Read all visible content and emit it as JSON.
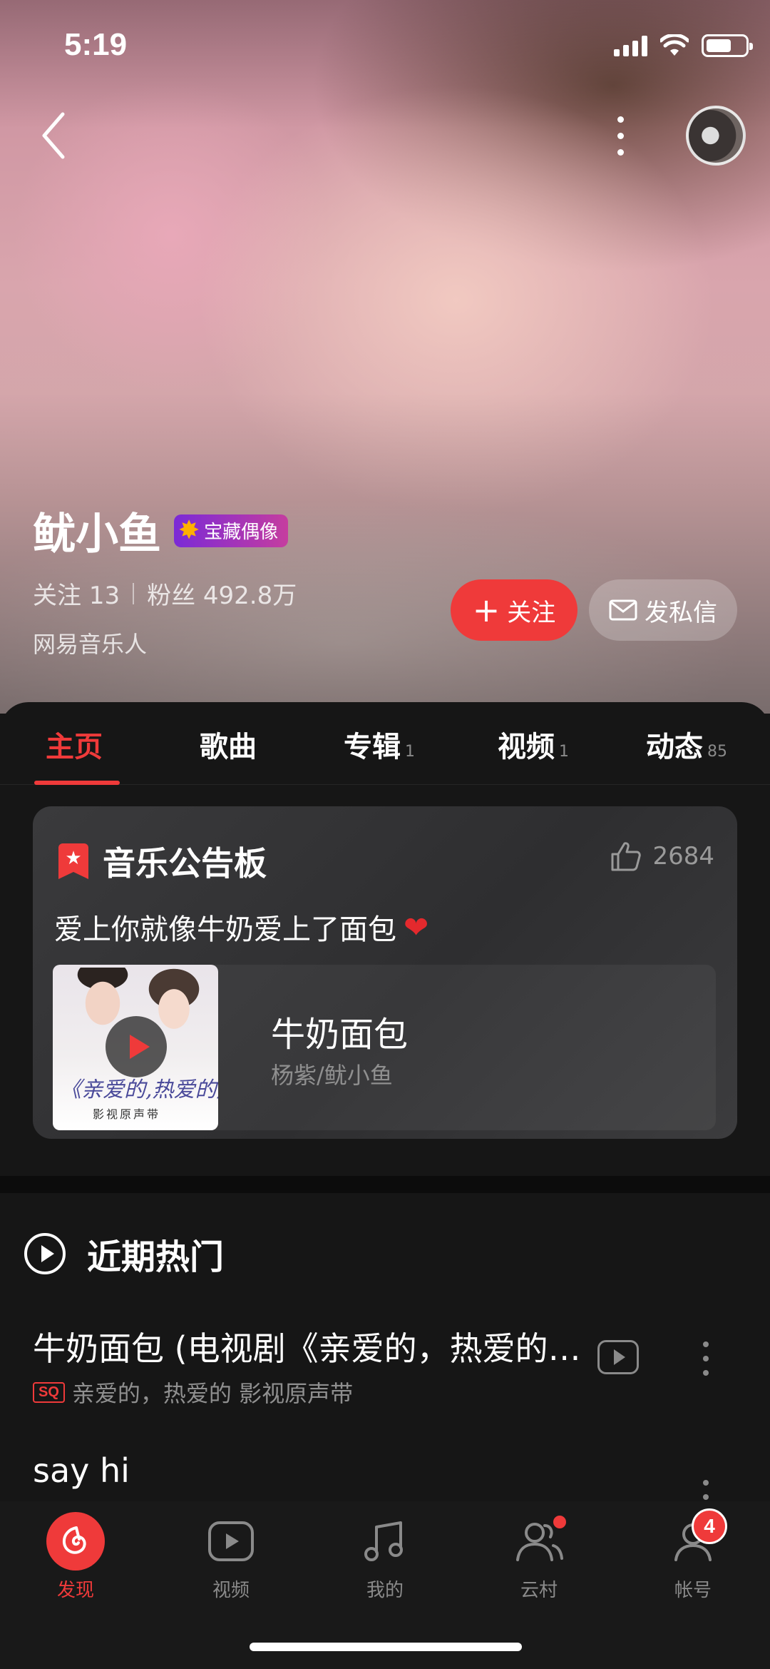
{
  "status_bar": {
    "time": "5:19"
  },
  "profile": {
    "name": "鱿小鱼",
    "badge": "宝藏偶像",
    "following_label": "关注",
    "following_count": "13",
    "fans_label": "粉丝",
    "fans_count": "492.8万",
    "tag": "网易音乐人",
    "follow_button": "关注",
    "message_button": "发私信"
  },
  "tabs": [
    {
      "label": "主页",
      "count": ""
    },
    {
      "label": "歌曲",
      "count": ""
    },
    {
      "label": "专辑",
      "count": "1"
    },
    {
      "label": "视频",
      "count": "1"
    },
    {
      "label": "动态",
      "count": "85"
    }
  ],
  "board": {
    "title": "音乐公告板",
    "likes": "2684",
    "text": "爱上你就像牛奶爱上了面包",
    "song": {
      "title": "牛奶面包",
      "artist": "杨紫/鱿小鱼",
      "cover_title": "《亲爱的,热爱的》",
      "cover_sub": "影视原声带"
    }
  },
  "hot": {
    "title": "近期热门",
    "tracks": [
      {
        "title": "牛奶面包 (电视剧《亲爱的，热爱的》插曲)",
        "quality": "SQ",
        "album": "亲爱的，热爱的 影视原声带"
      },
      {
        "title": "say hi",
        "quality": "",
        "album": ""
      }
    ]
  },
  "bottom_nav": {
    "items": [
      {
        "label": "发现"
      },
      {
        "label": "视频"
      },
      {
        "label": "我的"
      },
      {
        "label": "云村"
      },
      {
        "label": "帐号",
        "badge": "4"
      }
    ]
  },
  "colors": {
    "accent": "#ef3a3a",
    "background": "#161616",
    "badge_gradient_start": "#7b2ad6",
    "badge_gradient_end": "#c53d9f"
  }
}
